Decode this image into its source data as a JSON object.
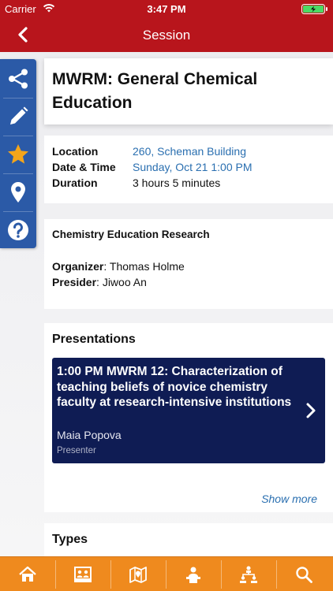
{
  "status": {
    "carrier": "Carrier",
    "time": "3:47 PM"
  },
  "nav": {
    "title": "Session"
  },
  "session": {
    "title": "MWRM: General Chemical Education",
    "location_label": "Location",
    "location_value": "260, Scheman Building",
    "datetime_label": "Date & Time",
    "datetime_value": "Sunday, Oct 21 1:00 PM",
    "duration_label": "Duration",
    "duration_value": "3 hours 5 minutes"
  },
  "info": {
    "heading": "Chemistry Education Research",
    "organizer_label": "Organizer",
    "organizer_value": ": Thomas Holme",
    "presider_label": "Presider",
    "presider_value": ": Jiwoo An"
  },
  "presentations": {
    "heading": "Presentations",
    "items": [
      {
        "title": "1:00 PM  MWRM 12: Characterization of teaching beliefs of novice chemistry faculty at research-intensive institutions",
        "name": "Maia Popova",
        "role": "Presenter"
      }
    ],
    "show_more": "Show more"
  },
  "types": {
    "heading": "Types"
  },
  "sidebar": {
    "icons": [
      "share-icon",
      "pencil-icon",
      "star-icon",
      "location-pin-icon",
      "help-icon"
    ]
  },
  "tabbar": {
    "icons": [
      "home-icon",
      "exhibitors-icon",
      "map-icon",
      "speaker-icon",
      "organization-icon",
      "search-icon"
    ]
  },
  "colors": {
    "header": "#b8151c",
    "sidebar": "#2b5aa7",
    "tabbar": "#ef8a1e",
    "presentation_card": "#0f1c54",
    "link": "#2a6fb0",
    "star": "#f3a51c"
  }
}
